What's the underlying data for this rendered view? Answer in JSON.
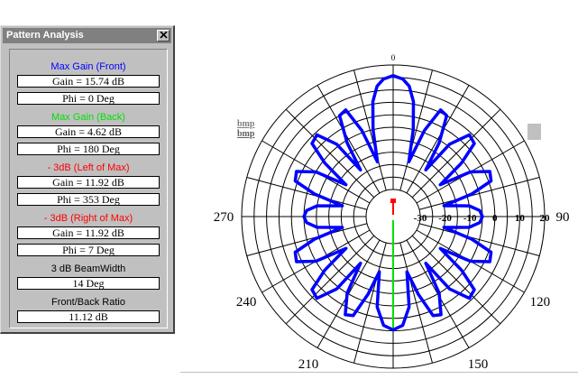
{
  "dialog": {
    "title": "Pattern Analysis",
    "sections": [
      {
        "header": "Max Gain (Front)",
        "color": "#0000ff",
        "values": [
          "Gain = 15.74 dB",
          "Phi = 0 Deg"
        ]
      },
      {
        "header": "Max Gain (Back)",
        "color": "#00e000",
        "values": [
          "Gain = 4.62 dB",
          "Phi = 180 Deg"
        ]
      },
      {
        "header": "- 3dB (Left of Max)",
        "color": "#ff0000",
        "values": [
          "Gain = 11.92 dB",
          "Phi = 353 Deg"
        ]
      },
      {
        "header": "- 3dB (Right of Max)",
        "color": "#ff0000",
        "values": [
          "Gain = 11.92 dB",
          "Phi = 7 Deg"
        ]
      },
      {
        "header": "3 dB BeamWidth",
        "color": "#000000",
        "values": [
          "14 Deg"
        ]
      },
      {
        "header": "Front/Back Ratio",
        "color": "#000000",
        "values": [
          "11.12 dB"
        ]
      }
    ]
  },
  "side_labels": {
    "line1": "bmp",
    "line2": "bmp"
  },
  "icons": {
    "close": "close-x-icon"
  },
  "chart_data": {
    "type": "polar",
    "angle_labels": [
      {
        "deg": 90,
        "label": "90"
      },
      {
        "deg": 120,
        "label": "120"
      },
      {
        "deg": 150,
        "label": "150"
      },
      {
        "deg": 180,
        "label": "180"
      },
      {
        "deg": 210,
        "label": "210"
      },
      {
        "deg": 240,
        "label": "240"
      },
      {
        "deg": 270,
        "label": "270"
      },
      {
        "deg": 0,
        "label": "0"
      }
    ],
    "radial_labels": [
      "-30",
      "-20",
      "-10",
      "0",
      "10",
      "20"
    ],
    "radial_range_db": [
      -30,
      20
    ],
    "rings_db": [
      -30,
      -25,
      -20,
      -15,
      -10,
      -5,
      0,
      5,
      10,
      15,
      20
    ],
    "spoke_step_deg": 15,
    "pattern_color": "#0000ff",
    "front_marker": {
      "phi": 0,
      "gain_db": 15.74,
      "color": "#ff0000"
    },
    "back_marker": {
      "phi": 180,
      "gain_db": 4.62,
      "color": "#00e000"
    },
    "beam_edges": [
      {
        "phi": 353,
        "gain_db": 11.92
      },
      {
        "phi": 7,
        "gain_db": 11.92
      }
    ],
    "pattern": [
      {
        "phi": 0,
        "db": 15.74
      },
      {
        "phi": 4,
        "db": 14.5
      },
      {
        "phi": 7,
        "db": 11.92
      },
      {
        "phi": 10,
        "db": 6
      },
      {
        "phi": 13,
        "db": -5
      },
      {
        "phi": 16,
        "db": -18
      },
      {
        "phi": 20,
        "db": -4
      },
      {
        "phi": 24,
        "db": 6
      },
      {
        "phi": 28,
        "db": 5
      },
      {
        "phi": 32,
        "db": -6
      },
      {
        "phi": 35,
        "db": -18
      },
      {
        "phi": 38,
        "db": -4
      },
      {
        "phi": 43,
        "db": 4
      },
      {
        "phi": 48,
        "db": 3
      },
      {
        "phi": 52,
        "db": -6
      },
      {
        "phi": 56,
        "db": -18
      },
      {
        "phi": 60,
        "db": -5
      },
      {
        "phi": 65,
        "db": 2
      },
      {
        "phi": 70,
        "db": 1
      },
      {
        "phi": 74,
        "db": -8
      },
      {
        "phi": 78,
        "db": -20
      },
      {
        "phi": 82,
        "db": -10
      },
      {
        "phi": 86,
        "db": -6
      },
      {
        "phi": 90,
        "db": -5
      },
      {
        "phi": 94,
        "db": -6
      },
      {
        "phi": 98,
        "db": -10
      },
      {
        "phi": 102,
        "db": -20
      },
      {
        "phi": 106,
        "db": -8
      },
      {
        "phi": 110,
        "db": 1
      },
      {
        "phi": 115,
        "db": 2
      },
      {
        "phi": 120,
        "db": -5
      },
      {
        "phi": 124,
        "db": -18
      },
      {
        "phi": 128,
        "db": -6
      },
      {
        "phi": 132,
        "db": 3
      },
      {
        "phi": 137,
        "db": 4
      },
      {
        "phi": 142,
        "db": -4
      },
      {
        "phi": 145,
        "db": -18
      },
      {
        "phi": 149,
        "db": -5
      },
      {
        "phi": 154,
        "db": 3
      },
      {
        "phi": 158,
        "db": 2
      },
      {
        "phi": 162,
        "db": -8
      },
      {
        "phi": 166,
        "db": -18
      },
      {
        "phi": 170,
        "db": -4
      },
      {
        "phi": 175,
        "db": 3
      },
      {
        "phi": 180,
        "db": 4.62
      },
      {
        "phi": 185,
        "db": 3
      },
      {
        "phi": 190,
        "db": -4
      },
      {
        "phi": 194,
        "db": -18
      },
      {
        "phi": 198,
        "db": -8
      },
      {
        "phi": 202,
        "db": 2
      },
      {
        "phi": 206,
        "db": 3
      },
      {
        "phi": 211,
        "db": -5
      },
      {
        "phi": 215,
        "db": -18
      },
      {
        "phi": 218,
        "db": -4
      },
      {
        "phi": 223,
        "db": 4
      },
      {
        "phi": 228,
        "db": 3
      },
      {
        "phi": 232,
        "db": -6
      },
      {
        "phi": 236,
        "db": -18
      },
      {
        "phi": 240,
        "db": -5
      },
      {
        "phi": 245,
        "db": 2
      },
      {
        "phi": 250,
        "db": 1
      },
      {
        "phi": 254,
        "db": -8
      },
      {
        "phi": 258,
        "db": -20
      },
      {
        "phi": 262,
        "db": -10
      },
      {
        "phi": 266,
        "db": -6
      },
      {
        "phi": 270,
        "db": -5
      },
      {
        "phi": 274,
        "db": -6
      },
      {
        "phi": 278,
        "db": -10
      },
      {
        "phi": 282,
        "db": -20
      },
      {
        "phi": 286,
        "db": -8
      },
      {
        "phi": 290,
        "db": 1
      },
      {
        "phi": 295,
        "db": 2
      },
      {
        "phi": 300,
        "db": -5
      },
      {
        "phi": 304,
        "db": -18
      },
      {
        "phi": 308,
        "db": -6
      },
      {
        "phi": 312,
        "db": 3
      },
      {
        "phi": 317,
        "db": 4
      },
      {
        "phi": 322,
        "db": -4
      },
      {
        "phi": 325,
        "db": -18
      },
      {
        "phi": 328,
        "db": -6
      },
      {
        "phi": 332,
        "db": 5
      },
      {
        "phi": 336,
        "db": 6
      },
      {
        "phi": 340,
        "db": -4
      },
      {
        "phi": 344,
        "db": -18
      },
      {
        "phi": 347,
        "db": -5
      },
      {
        "phi": 350,
        "db": 6
      },
      {
        "phi": 353,
        "db": 11.92
      },
      {
        "phi": 356,
        "db": 14.5
      },
      {
        "phi": 360,
        "db": 15.74
      }
    ]
  }
}
